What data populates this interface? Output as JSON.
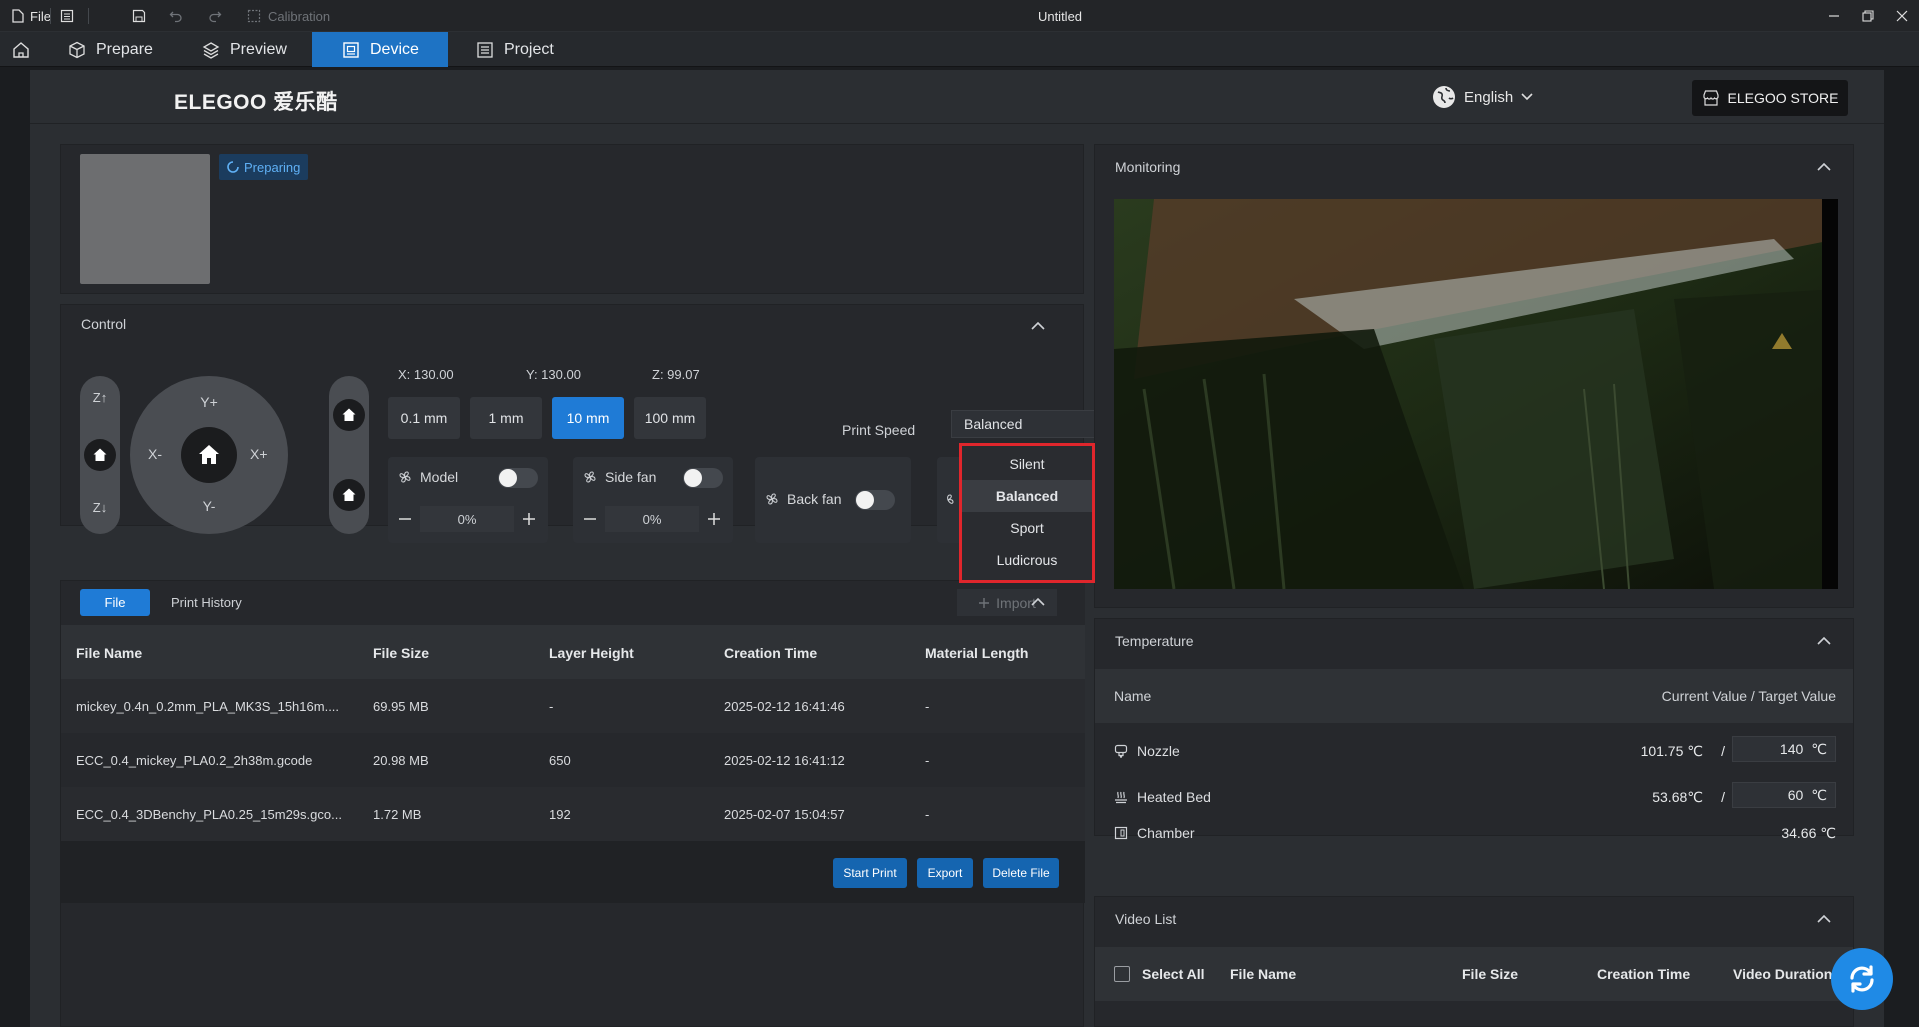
{
  "titlebar": {
    "file_label": "File",
    "calibration_label": "Calibration",
    "window_title": "Untitled"
  },
  "nav": {
    "tabs": [
      {
        "label": "Prepare",
        "icon": "cube-icon"
      },
      {
        "label": "Preview",
        "icon": "layers-icon"
      },
      {
        "label": "Device",
        "icon": "device-icon",
        "active": true
      },
      {
        "label": "Project",
        "icon": "project-icon"
      }
    ]
  },
  "header": {
    "brand": "ELEGOO 爱乐酷",
    "language": "English",
    "store_label": "ELEGOO STORE"
  },
  "status": {
    "badge": "Preparing"
  },
  "control": {
    "title": "Control",
    "jog": {
      "zup": "Z↑",
      "zdown": "Z↓",
      "yplus": "Y+",
      "yminus": "Y-",
      "xminus": "X-",
      "xplus": "X+"
    },
    "coords": {
      "x": "X:  130.00",
      "y": "Y:  130.00",
      "z": "Z:  99.07"
    },
    "steps": [
      "0.1 mm",
      "1 mm",
      "10 mm",
      "100 mm"
    ],
    "active_step": "10 mm",
    "print_speed_label": "Print Speed",
    "print_speed_value": "Balanced",
    "speed_options": [
      "Silent",
      "Balanced",
      "Sport",
      "Ludicrous"
    ],
    "fans": {
      "model": {
        "label": "Model",
        "value": "0%",
        "on": false
      },
      "side": {
        "label": "Side fan",
        "value": "0%",
        "on": false
      },
      "back": {
        "label": "Back fan",
        "on": false
      }
    }
  },
  "files": {
    "tab_file": "File",
    "tab_history": "Print History",
    "import_label": "Import",
    "columns": [
      "File Name",
      "File Size",
      "Layer Height",
      "Creation Time",
      "Material Length"
    ],
    "rows": [
      {
        "name": "mickey_0.4n_0.2mm_PLA_MK3S_15h16m....",
        "size": "69.95 MB",
        "layer": "-",
        "time": "2025-02-12 16:41:46",
        "material": "-"
      },
      {
        "name": "ECC_0.4_mickey_PLA0.2_2h38m.gcode",
        "size": "20.98 MB",
        "layer": "650",
        "time": "2025-02-12 16:41:12",
        "material": "-"
      },
      {
        "name": "ECC_0.4_3DBenchy_PLA0.25_15m29s.gco...",
        "size": "1.72 MB",
        "layer": "192",
        "time": "2025-02-07 15:04:57",
        "material": "-"
      }
    ],
    "start_print": "Start Print",
    "export": "Export",
    "delete": "Delete File"
  },
  "monitoring": {
    "title": "Monitoring"
  },
  "temperature": {
    "title": "Temperature",
    "col_name": "Name",
    "col_values": "Current Value / Target Value",
    "rows": [
      {
        "name": "Nozzle",
        "current": "101.75 ℃",
        "target": "140",
        "unit": "℃",
        "icon": "nozzle-icon"
      },
      {
        "name": "Heated Bed",
        "current": "53.68℃",
        "target": "60",
        "unit": "℃",
        "icon": "heated-bed-icon"
      },
      {
        "name": "Chamber",
        "current": "34.66 ℃",
        "icon": "chamber-icon"
      }
    ],
    "slash": "/"
  },
  "video_list": {
    "title": "Video List",
    "select_all": "Select All",
    "columns": [
      "File Name",
      "File Size",
      "Creation Time",
      "Video Duration"
    ]
  },
  "colors": {
    "accent": "#1f7bd6",
    "highlight_box": "#e0262c"
  }
}
